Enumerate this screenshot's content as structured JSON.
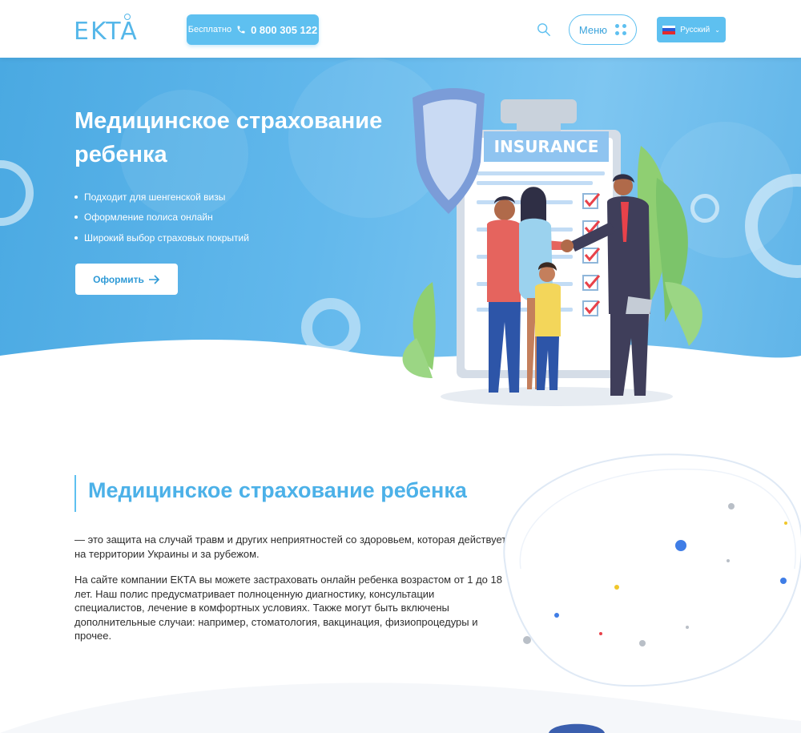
{
  "header": {
    "logo": "EKTA",
    "phone_prefix": "Бесплатно",
    "phone_number": "0 800 305 122",
    "menu_label": "Меню",
    "language": "Русский"
  },
  "hero": {
    "title": "Медицинское страхование ребенка",
    "features": [
      "Подходит для шенгенской визы",
      "Оформление полиса онлайн",
      "Широкий выбор страховых покрытий"
    ],
    "cta_label": "Оформить",
    "clipboard_text": "INSURANCE"
  },
  "content": {
    "title": "Медицинское страхование ребенка",
    "paragraph1": "— это защита на случай травм и других неприятностей со здоровьем, которая действует на территории Украины и за рубежом.",
    "paragraph2": "На сайте компании ЕКТА вы можете застраховать онлайн ребенка возрастом от 1 до 18 лет. Наш полис предусматривает полноценную диагностику, консультации специалистов, лечение в комфортных условиях. Также могут быть включены дополнительные случаи: например, стоматология, вакцинация, физиопроцедуры и прочее."
  },
  "colors": {
    "accent": "#5ec0f0",
    "title_blue": "#4cb1e8"
  },
  "icons": {
    "phone": "phone-icon",
    "search": "search-icon",
    "menu": "dots-grid-icon",
    "arrow": "arrow-right-icon",
    "flag": "russia-flag-icon"
  }
}
